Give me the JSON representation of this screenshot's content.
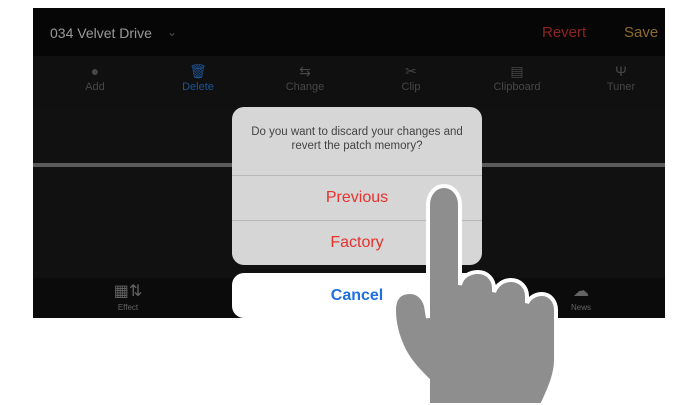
{
  "header": {
    "patch_name": "034 Velvet Drive",
    "revert_label": "Revert",
    "save_label": "Save"
  },
  "toolbar": {
    "items": [
      {
        "label": "Add",
        "icon": "plus-circle-icon"
      },
      {
        "label": "Delete",
        "icon": "trash-icon",
        "active": true
      },
      {
        "label": "Change",
        "icon": "change-icon"
      },
      {
        "label": "Clip",
        "icon": "scissors-icon"
      },
      {
        "label": "Clipboard",
        "icon": "clipboard-icon"
      },
      {
        "label": "Tuner",
        "icon": "tuning-fork-icon"
      }
    ]
  },
  "bottombar": {
    "items": [
      {
        "label": "Effect",
        "icon": "effect-icon"
      },
      {
        "label": "News",
        "icon": "cloud-download-icon"
      }
    ]
  },
  "dialog": {
    "message": "Do you want to discard your changes and revert the patch memory?",
    "options": [
      "Previous",
      "Factory"
    ],
    "cancel_label": "Cancel"
  },
  "colors": {
    "revert": "#d8362f",
    "save": "#d9a441",
    "active_tool": "#2f7ee0",
    "destructive": "#e5322d",
    "cancel": "#1f6fe0"
  }
}
